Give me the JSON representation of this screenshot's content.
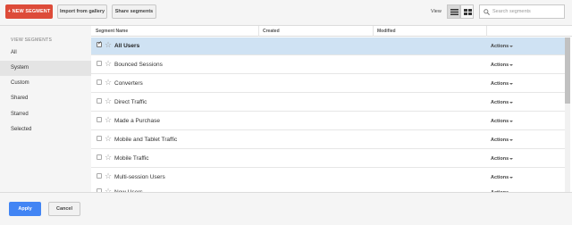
{
  "toolbar": {
    "new_segment": "+ NEW SEGMENT",
    "import": "Import from gallery",
    "share": "Share segments",
    "view_label": "View",
    "search_placeholder": "Search segments",
    "list_view_icon": "list-view-icon",
    "grid_view_icon": "grid-view-icon",
    "search_icon": "search-icon"
  },
  "sidebar": {
    "heading": "VIEW SEGMENTS",
    "items": [
      {
        "label": "All",
        "active": false
      },
      {
        "label": "System",
        "active": true
      },
      {
        "label": "Custom",
        "active": false
      },
      {
        "label": "Shared",
        "active": false
      },
      {
        "label": "Starred",
        "active": false
      },
      {
        "label": "Selected",
        "active": false
      }
    ]
  },
  "table": {
    "columns": [
      "Segment Name",
      "Created",
      "Modified"
    ],
    "rows": [
      {
        "name": "All Users",
        "checked": true,
        "actions": "Actions"
      },
      {
        "name": "Bounced Sessions",
        "checked": false,
        "actions": "Actions"
      },
      {
        "name": "Converters",
        "checked": false,
        "actions": "Actions"
      },
      {
        "name": "Direct Traffic",
        "checked": false,
        "actions": "Actions"
      },
      {
        "name": "Made a Purchase",
        "checked": false,
        "actions": "Actions"
      },
      {
        "name": "Mobile and Tablet Traffic",
        "checked": false,
        "actions": "Actions"
      },
      {
        "name": "Mobile Traffic",
        "checked": false,
        "actions": "Actions"
      },
      {
        "name": "Multi-session Users",
        "checked": false,
        "actions": "Actions"
      },
      {
        "name": "New Users",
        "checked": false,
        "actions": "Actions"
      }
    ]
  },
  "footer": {
    "apply": "Apply",
    "cancel": "Cancel"
  },
  "colors": {
    "new_segment_bg": "#dd4b39",
    "apply_bg": "#4285f4",
    "selected_row_bg": "#cfe2f3"
  }
}
